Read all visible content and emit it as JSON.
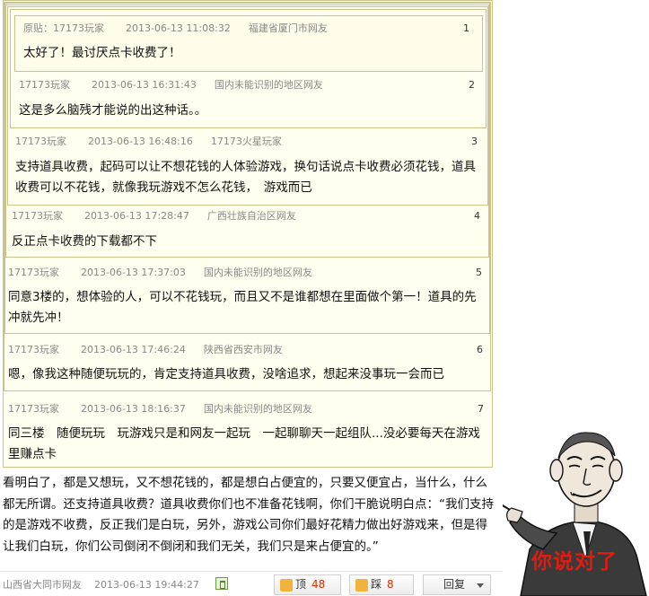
{
  "quotes": [
    {
      "user": "原贴：17173玩家",
      "time": "2013-06-13 11:08:32",
      "location": "福建省厦门市网友",
      "floor": "1",
      "text": "太好了！最讨厌点卡收费了！"
    },
    {
      "user": "17173玩家",
      "time": "2013-06-13 16:31:43",
      "location": "国内未能识别的地区网友",
      "floor": "2",
      "text": "这是多么脑残才能说的出这种话。。"
    },
    {
      "user": "17173玩家",
      "time": "2013-06-13 16:48:16",
      "location": "17173火星玩家",
      "floor": "3",
      "text": "支持道具收费，起码可以让不想花钱的人体验游戏，换句话说点卡收费必须花钱，道具收费可以不花钱，就像我玩游戏不怎么花钱，　游戏而已"
    },
    {
      "user": "17173玩家",
      "time": "2013-06-13 17:28:47",
      "location": "广西壮族自治区网友",
      "floor": "4",
      "text": "反正点卡收费的下载都不下"
    },
    {
      "user": "17173玩家",
      "time": "2013-06-13 17:37:03",
      "location": "国内未能识别的地区网友",
      "floor": "5",
      "text": "同意3楼的，想体验的人，可以不花钱玩，而且又不是谁都想在里面做个第一！道具的先冲就先冲！"
    },
    {
      "user": "17173玩家",
      "time": "2013-06-13 17:46:24",
      "location": "陕西省西安市网友",
      "floor": "6",
      "text": "嗯，像我这种随便玩玩的，肯定支持道具收费，没啥追求，想起来没事玩一会而已"
    },
    {
      "user": "17173玩家",
      "time": "2013-06-13 18:16:37",
      "location": "国内未能识别的地区网友",
      "floor": "7",
      "text": "同三楼　随便玩玩　玩游戏只是和网友一起玩　一起聊聊天一起组队...没必要每天在游戏里赚点卡"
    }
  ],
  "main_comment": {
    "text": "看明白了，都是又想玩，又不想花钱的，都是想白占便宜的，只要又便宜占，当什么，什么都无所谓。还支持道具收费？道具收费你们也不准备花钱啊，你们干脆说明白点：“我们支持的是游戏不收费，反正我们是白玩，另外，游戏公司你们最好花精力做出好游戏来，但是得让我们白玩，你们公司倒闭不倒闭和我们无关，我们只是来占便宜的。”",
    "location": "山西省大同市网友",
    "time": "2013-06-13 19:44:27"
  },
  "actions": {
    "up_label": "顶",
    "up_count": "48",
    "down_label": "踩",
    "down_count": "8",
    "reply_label": "回复"
  },
  "meme": {
    "caption": "你说对了"
  }
}
